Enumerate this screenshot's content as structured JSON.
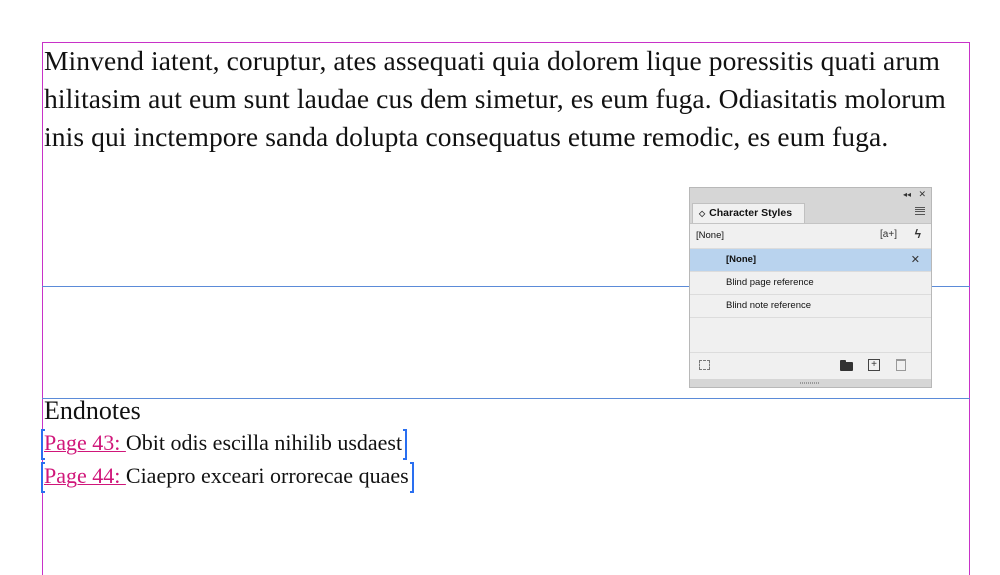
{
  "document": {
    "body_text": "Minvend iatent, coruptur, ates assequati quia dolorem lique poressitis quati arum hilitasim aut eum sunt laudae cus dem simetur, es eum fuga. Odiasitatis molorum inis qui inctempore sanda dolupta consequatus etume remodic, es eum fuga.",
    "endnotes_heading": "Endnotes",
    "endnotes": [
      {
        "ref": "Page 43: ",
        "text": "Obit odis escilla nihilib usdaest"
      },
      {
        "ref": "Page 44: ",
        "text": "Ciaepro exceari orrorecae quaes"
      }
    ],
    "colors": {
      "margin_guide": "#c832c8",
      "column_guide": "#5b8bd8",
      "reference_link": "#d0167a",
      "text_frame_bracket": "#2a6ff0"
    }
  },
  "panel": {
    "collapse_glyph": "◂◂",
    "close_glyph": "✕",
    "tab_label": "Character Styles",
    "current_style": "[None]",
    "new_style_glyph": "[a+]",
    "quick_apply_glyph": "ϟ",
    "styles": [
      {
        "label": "[None]",
        "selected": true
      },
      {
        "label": "Blind page reference",
        "selected": false
      },
      {
        "label": "Blind note reference",
        "selected": false
      }
    ],
    "icons": [
      "chevron-updown-icon",
      "panel-menu-icon",
      "new-style-icon",
      "lightning-icon",
      "no-override-icon",
      "load-styles-icon",
      "folder-icon",
      "new-icon",
      "trash-icon"
    ],
    "selected_color": "#b9d3ee"
  }
}
